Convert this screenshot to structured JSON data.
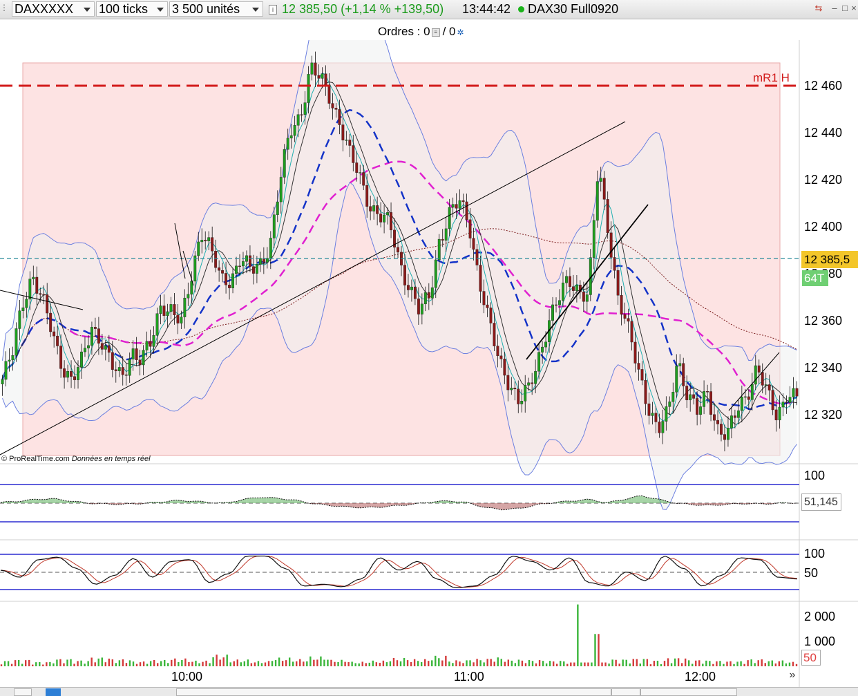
{
  "toolbar": {
    "instrument": "DAXXXXX",
    "ticks": "100 ticks",
    "units": "3 500 unités",
    "info": "i",
    "quote": "12 385,50 (+1,14 % +139,50)",
    "time": "13:44:42",
    "market": "DAX30 Full0920",
    "minimize": "–",
    "maximize": "□",
    "close": "×"
  },
  "orders": {
    "label": "Ordres : 0",
    "pending": "/ 0"
  },
  "price_axis": {
    "labels": [
      "12 460",
      "12 440",
      "12 420",
      "12 400",
      "12 380",
      "12 360",
      "12 340",
      "12 320"
    ],
    "current_price": "12 385,5",
    "tick_count": "64T",
    "pivot_label": "mR1 H"
  },
  "rsi_axis": {
    "labels": [
      "100"
    ],
    "current": "51,145"
  },
  "stoch_axis": {
    "labels": [
      "100",
      "50"
    ]
  },
  "volume_axis": {
    "labels": [
      "2 000",
      "1 000"
    ],
    "current": "50"
  },
  "time_axis": {
    "labels": [
      "10:00",
      "11:00",
      "12:00"
    ]
  },
  "credit": {
    "source": "© ProRealTime.com",
    "note": "Données en temps réel"
  },
  "colors": {
    "up": "#1f9e1f",
    "down": "#8b1a1a",
    "zone": "#fde3e3",
    "pivot": "#d21a1a",
    "ma_blue": "#1433c8",
    "ma_magenta": "#e020d0",
    "current_line": "#2a8c9a",
    "price_box": "#f3c62a"
  },
  "chart_data": [
    {
      "type": "candlestick",
      "title": "DAXXXXX 100 ticks",
      "xlabel": "",
      "ylabel": "",
      "x_ticks": [
        "10:00",
        "11:00",
        "12:00"
      ],
      "ylim": [
        12300,
        12475
      ],
      "y_ticks": [
        12460,
        12440,
        12420,
        12400,
        12380,
        12360,
        12340,
        12320
      ],
      "current_price": 12385.5,
      "pivot_mR1_H": 12459,
      "path_close": [
        12335,
        12345,
        12368,
        12380,
        12368,
        12355,
        12342,
        12334,
        12342,
        12358,
        12352,
        12340,
        12335,
        12348,
        12343,
        12350,
        12368,
        12365,
        12358,
        12378,
        12400,
        12390,
        12376,
        12378,
        12388,
        12380,
        12384,
        12395,
        12420,
        12440,
        12448,
        12468,
        12462,
        12455,
        12445,
        12430,
        12420,
        12410,
        12405,
        12400,
        12385,
        12375,
        12363,
        12370,
        12395,
        12405,
        12410,
        12402,
        12378,
        12358,
        12343,
        12335,
        12325,
        12330,
        12345,
        12360,
        12368,
        12378,
        12374,
        12370,
        12425,
        12400,
        12370,
        12355,
        12340,
        12325,
        12312,
        12320,
        12345,
        12328,
        12320,
        12330,
        12315,
        12310,
        12322,
        12330,
        12340,
        12328,
        12320,
        12330,
        12326
      ]
    },
    {
      "type": "line",
      "title": "",
      "ylim": [
        0,
        100
      ],
      "reference_lines": [
        100,
        50,
        0
      ],
      "last_value": 51.145,
      "values": [
        52,
        55,
        60,
        62,
        56,
        50,
        48,
        47,
        49,
        52,
        57,
        56,
        52,
        50,
        60,
        66,
        63,
        58,
        49,
        44,
        40,
        38,
        40,
        44,
        48,
        54,
        56,
        51,
        38,
        33,
        36,
        46,
        52,
        56,
        60,
        51,
        60,
        70,
        60,
        50,
        46,
        44,
        47,
        49,
        48,
        50,
        51
      ]
    },
    {
      "type": "line",
      "title": "",
      "ylim": [
        0,
        100
      ],
      "reference_lines": [
        100,
        50,
        0
      ],
      "values": [
        55,
        35,
        85,
        92,
        60,
        15,
        40,
        88,
        35,
        80,
        85,
        20,
        45,
        95,
        95,
        60,
        10,
        15,
        8,
        30,
        90,
        55,
        80,
        30,
        5,
        10,
        40,
        95,
        80,
        55,
        90,
        20,
        10,
        50,
        25,
        95,
        60,
        10,
        40,
        90,
        85,
        35,
        30
      ]
    },
    {
      "type": "bar",
      "title": "Volume",
      "ylim": [
        0,
        2500
      ],
      "y_ticks": [
        2000,
        1000
      ],
      "last_value": 50,
      "values": [
        150,
        180,
        120,
        200,
        160,
        240,
        190,
        130,
        170,
        210,
        150,
        310,
        180,
        140,
        230,
        190,
        260,
        170,
        120,
        150,
        220,
        190,
        280,
        160,
        200,
        240,
        180,
        170,
        150,
        2450,
        1280,
        190,
        210,
        160,
        230,
        170,
        150,
        140,
        190,
        160,
        120
      ]
    }
  ]
}
